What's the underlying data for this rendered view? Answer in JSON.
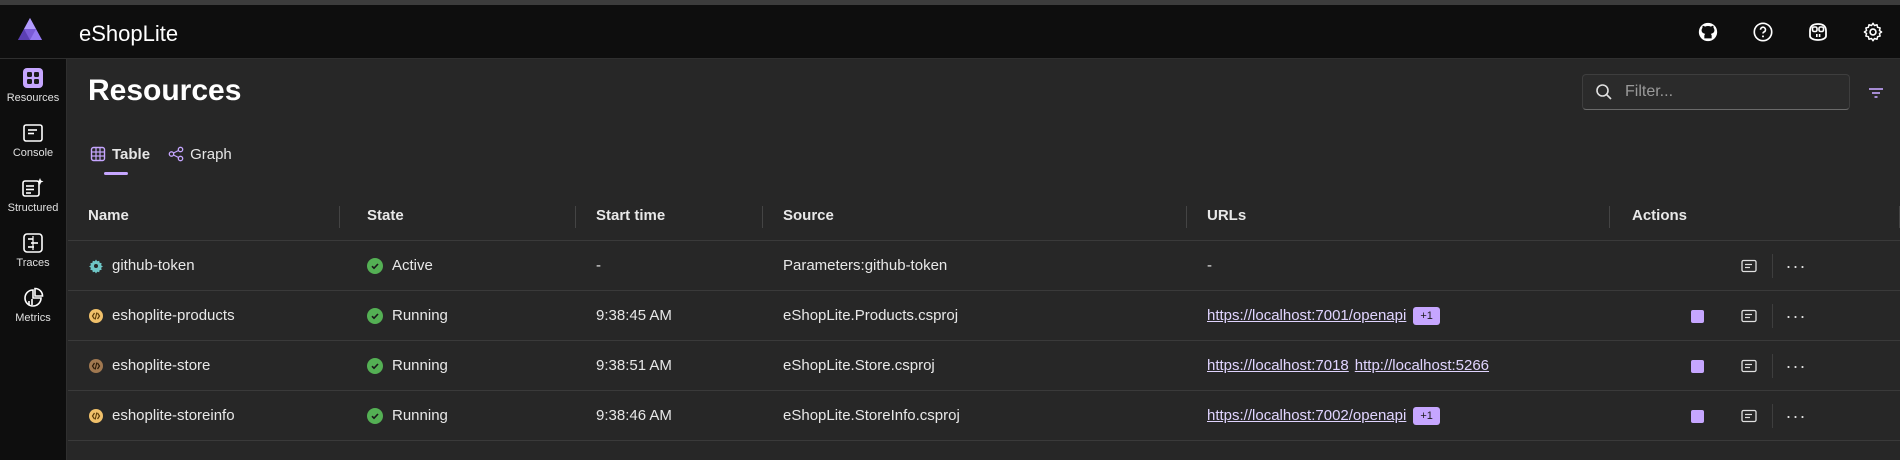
{
  "app": {
    "title": "eShopLite"
  },
  "header_icons": [
    "github-icon",
    "help-icon",
    "copilot-icon",
    "settings-icon"
  ],
  "sidebar": {
    "items": [
      {
        "label": "Resources",
        "icon": "resources-icon",
        "active": true
      },
      {
        "label": "Console",
        "icon": "console-icon"
      },
      {
        "label": "Structured",
        "icon": "structured-icon"
      },
      {
        "label": "Traces",
        "icon": "traces-icon"
      },
      {
        "label": "Metrics",
        "icon": "metrics-icon"
      }
    ]
  },
  "page": {
    "title": "Resources",
    "filter_placeholder": "Filter...",
    "tabs": [
      {
        "label": "Table",
        "active": true
      },
      {
        "label": "Graph",
        "active": false
      }
    ]
  },
  "table": {
    "columns": [
      "Name",
      "State",
      "Start time",
      "Source",
      "URLs",
      "Actions"
    ],
    "rows": [
      {
        "name": "github-token",
        "icon": "parameter-icon",
        "state": "Active",
        "start": "-",
        "source": "Parameters:github-token",
        "urls": [],
        "url_text": "-",
        "extra": "",
        "has_stop": false
      },
      {
        "name": "eshoplite-products",
        "icon": "project-icon",
        "state": "Running",
        "start": "9:38:45 AM",
        "source": "eShopLite.Products.csproj",
        "urls": [
          "https://localhost:7001/openapi"
        ],
        "extra": "+1",
        "has_stop": true
      },
      {
        "name": "eshoplite-store",
        "icon": "project-icon",
        "state": "Running",
        "start": "9:38:51 AM",
        "source": "eShopLite.Store.csproj",
        "urls": [
          "https://localhost:7018",
          "http://localhost:5266"
        ],
        "extra": "",
        "has_stop": true
      },
      {
        "name": "eshoplite-storeinfo",
        "icon": "project-icon",
        "state": "Running",
        "start": "9:38:46 AM",
        "source": "eShopLite.StoreInfo.csproj",
        "urls": [
          "https://localhost:7002/openapi"
        ],
        "extra": "+1",
        "has_stop": true
      }
    ]
  },
  "colors": {
    "accent": "#c6a6ff",
    "running": "#54b054",
    "background": "#272727",
    "chrome": "#0e0e0e"
  }
}
